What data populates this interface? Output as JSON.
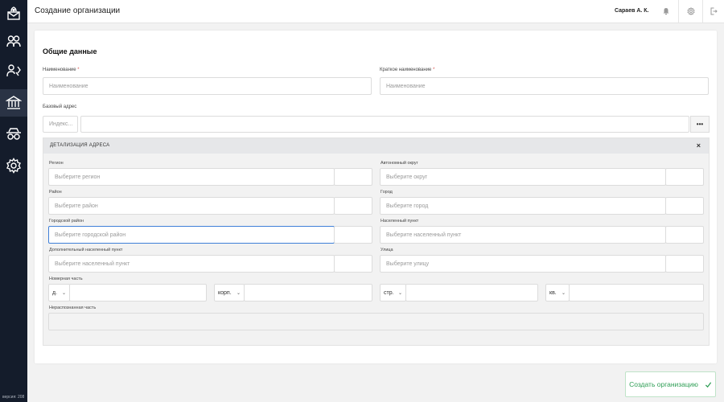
{
  "sidebar": {
    "version": "версия: 208",
    "items": [
      {
        "icon": "envelope-pin-icon"
      },
      {
        "icon": "users-icon"
      },
      {
        "icon": "user-arrows-icon"
      },
      {
        "icon": "bank-icon"
      },
      {
        "icon": "spy-icon"
      },
      {
        "icon": "gear-icon"
      }
    ]
  },
  "header": {
    "title": "Создание организации",
    "user": "Сараев А. К."
  },
  "form": {
    "section_title": "Общие данные",
    "name_label": "Наименование",
    "name_placeholder": "Наименование",
    "short_name_label": "Краткое наименование",
    "short_name_placeholder": "Наименование",
    "required_mark": "*",
    "base_address_label": "Базовый адрес",
    "index_placeholder": "Индекс...",
    "dots": "•••"
  },
  "detail": {
    "title": "ДЕТАЛИЗАЦИЯ АДРЕСА",
    "close": "×",
    "region_label": "Регион",
    "region_placeholder": "Выберите регион",
    "okrug_label": "Автономный округ",
    "okrug_placeholder": "Выберите округ",
    "district_label": "Район",
    "district_placeholder": "Выберите район",
    "city_label": "Город",
    "city_placeholder": "Выберите город",
    "city_district_label": "Городской район",
    "city_district_placeholder": "Выберите городской район",
    "settlement_label": "Населенный пункт",
    "settlement_placeholder": "Выберите населенный пункт",
    "extra_settlement_label": "Дополнительный населенный пункт",
    "extra_settlement_placeholder": "Выберите населенный пункт",
    "street_label": "Улица",
    "street_placeholder": "Выберите улицу",
    "number_label": "Номерная часть",
    "house_type": "д.",
    "corp_type": "корп.",
    "building_type": "стр.",
    "flat_type": "кв.",
    "unparsed_label": "Нераспознанная часть"
  },
  "actions": {
    "create_label": "Создать организацию"
  },
  "colors": {
    "sidebar": "#141c2b",
    "accent_green": "#2e9e55",
    "focus_blue": "#3f7fd8"
  }
}
